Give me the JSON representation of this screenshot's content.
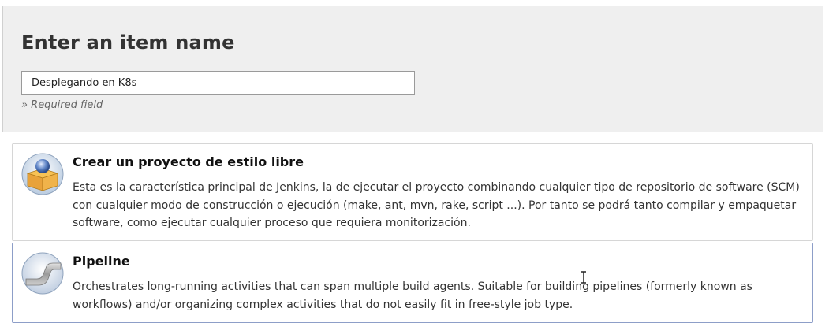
{
  "header": {
    "title": "Enter an item name",
    "name_input_value": "Desplegando en K8s",
    "required_note": "» Required field"
  },
  "items": [
    {
      "title": "Crear un proyecto de estilo libre",
      "description": "Esta es la característica principal de Jenkins, la de ejecutar el proyecto combinando cualquier tipo de repositorio de software (SCM) con cualquier modo de construcción o ejecución (make, ant, mvn, rake, script ...). Por tanto se podrá tanto compilar y empaquetar software, como ejecutar cualquier proceso que requiera monitorización.",
      "icon": "freestyle-project-icon"
    },
    {
      "title": "Pipeline",
      "description": "Orchestrates long-running activities that can span multiple build agents. Suitable for building pipelines (formerly known as workflows) and/or organizing complex activities that do not easily fit in free-style job type.",
      "icon": "pipeline-icon"
    }
  ],
  "colors": {
    "header_bg": "#efefef",
    "selected_border": "#8d9ec8"
  }
}
